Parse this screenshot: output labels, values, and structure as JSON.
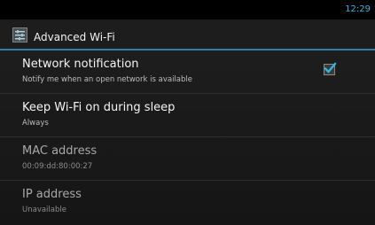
{
  "status_bar": {
    "time": "12:29"
  },
  "action_bar": {
    "title": "Advanced Wi-Fi",
    "icon": "settings-app-icon"
  },
  "preferences": [
    {
      "title": "Network notification",
      "summary": "Notify me when an open network is available",
      "enabled": true,
      "checked": true
    },
    {
      "title": "Keep Wi-Fi on during sleep",
      "summary": "Always",
      "enabled": true
    },
    {
      "title": "MAC address",
      "summary": "00:09:dd:80:00:27",
      "enabled": false
    },
    {
      "title": "IP address",
      "summary": "Unavailable",
      "enabled": false
    }
  ],
  "colors": {
    "accent": "#33b5e5",
    "divider": "#2f7fa6",
    "background": "#1a1a1a"
  }
}
